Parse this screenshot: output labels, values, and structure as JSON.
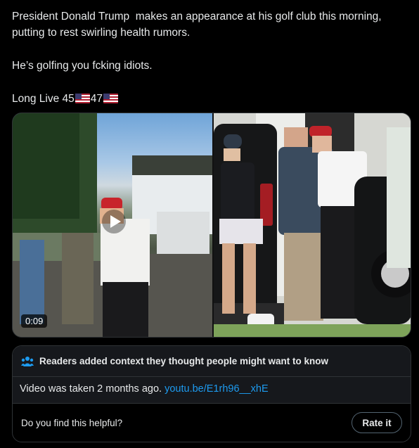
{
  "post": {
    "line1": "President Donald Trump  makes an appearance at his golf club this morning, putting to rest swirling health rumors.",
    "line2": "He’s golfing you fcking idiots.",
    "line3_prefix": "Long Live 45",
    "line3_mid": "47"
  },
  "media": {
    "left_video_duration": "0:09"
  },
  "community_note": {
    "title": "Readers added context they thought people might want to know",
    "body_text": "Video was taken 2 months ago. ",
    "link_text": "youtu.be/E1rh96__xhE",
    "question": "Do you find this helpful?",
    "rate_button": "Rate it"
  },
  "icons": {
    "flag": "us-flag-emoji",
    "play": "play-icon",
    "note": "people-icon"
  },
  "colors": {
    "link": "#1d9bf0",
    "background": "#000000",
    "note_header": "#16181c"
  }
}
